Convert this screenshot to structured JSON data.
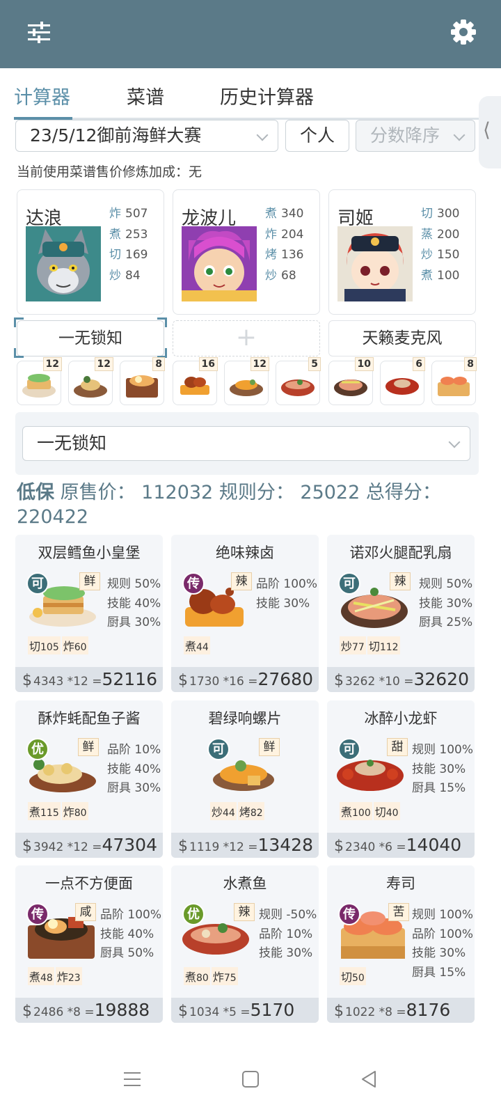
{
  "header": {
    "menu_icon": "sliders-icon",
    "settings_icon": "gear-icon",
    "bar_color": "#5b7a88"
  },
  "tabs": [
    {
      "label": "计算器",
      "active": true
    },
    {
      "label": "菜谱",
      "active": false
    },
    {
      "label": "历史计算器",
      "active": false
    }
  ],
  "filters": {
    "event": "23/5/12御前海鲜大赛",
    "mode": "个人",
    "sort": "分数降序"
  },
  "info_line": "当前使用菜谱售价修炼加成：无",
  "chefs": [
    {
      "name": "达浪",
      "stats": [
        {
          "k": "炸",
          "v": "507"
        },
        {
          "k": "煮",
          "v": "253"
        },
        {
          "k": "切",
          "v": "169"
        },
        {
          "k": "炒",
          "v": "84"
        }
      ]
    },
    {
      "name": "龙波儿",
      "stats": [
        {
          "k": "煮",
          "v": "340"
        },
        {
          "k": "炸",
          "v": "204"
        },
        {
          "k": "烤",
          "v": "136"
        },
        {
          "k": "炒",
          "v": "68"
        }
      ]
    },
    {
      "name": "司姬",
      "stats": [
        {
          "k": "切",
          "v": "300"
        },
        {
          "k": "蒸",
          "v": "200"
        },
        {
          "k": "炒",
          "v": "150"
        },
        {
          "k": "煮",
          "v": "100"
        }
      ]
    }
  ],
  "equips": [
    {
      "label": "一无锁知"
    },
    {
      "label": "+"
    },
    {
      "label": "天籁麦克风"
    }
  ],
  "ingredients": [
    "12",
    "12",
    "8",
    "16",
    "12",
    "5",
    "10",
    "6",
    "8"
  ],
  "panel": {
    "dropdown_value": "一无锁知"
  },
  "total": {
    "lowest": "低保",
    "text": " 原售价：  112032 规则分：  25022 总得分：",
    "score": "220422"
  },
  "recipes": [
    {
      "name": "双层鳕鱼小皇堡",
      "grade": "可",
      "flavor": "鲜",
      "bonus": [
        "规则 50%",
        "技能 40%",
        "厨具 30%"
      ],
      "skills": [
        {
          "k": "切",
          "v": "105"
        },
        {
          "k": "炸",
          "v": "60"
        }
      ],
      "price": "4343",
      "mult": "*12",
      "total": "52116"
    },
    {
      "name": "绝味辣卤",
      "grade": "传",
      "flavor": "辣",
      "bonus": [
        "品阶 100%",
        "技能 30%"
      ],
      "skills": [
        {
          "k": "煮",
          "v": "44"
        }
      ],
      "price": "1730",
      "mult": "*16",
      "total": "27680"
    },
    {
      "name": "诺邓火腿配乳扇",
      "grade": "可",
      "flavor": "辣",
      "bonus": [
        "规则 50%",
        "技能 30%",
        "厨具 25%"
      ],
      "skills": [
        {
          "k": "炒",
          "v": "77"
        },
        {
          "k": "切",
          "v": "112"
        }
      ],
      "price": "3262",
      "mult": "*10",
      "total": "32620"
    },
    {
      "name": "酥炸蚝配鱼子酱",
      "grade": "优",
      "flavor": "鲜",
      "bonus": [
        "品阶 10%",
        "技能 40%",
        "厨具 30%"
      ],
      "skills": [
        {
          "k": "煮",
          "v": "115"
        },
        {
          "k": "炸",
          "v": "80"
        }
      ],
      "price": "3942",
      "mult": "*12",
      "total": "47304"
    },
    {
      "name": "碧绿响螺片",
      "grade": "可",
      "flavor": "鲜",
      "bonus": [],
      "skills": [
        {
          "k": "炒",
          "v": "44"
        },
        {
          "k": "烤",
          "v": "82"
        }
      ],
      "price": "1119",
      "mult": "*12",
      "total": "13428"
    },
    {
      "name": "冰醉小龙虾",
      "grade": "可",
      "flavor": "甜",
      "bonus": [
        "规则 100%",
        "技能 30%",
        "厨具 15%"
      ],
      "skills": [
        {
          "k": "煮",
          "v": "100"
        },
        {
          "k": "切",
          "v": "40"
        }
      ],
      "price": "2340",
      "mult": "*6",
      "total": "14040"
    },
    {
      "name": "一点不方便面",
      "grade": "传",
      "flavor": "咸",
      "bonus": [
        "品阶 100%",
        "技能 40%",
        "厨具 50%"
      ],
      "skills": [
        {
          "k": "煮",
          "v": "48"
        },
        {
          "k": "炸",
          "v": "23"
        }
      ],
      "price": "2486",
      "mult": "*8",
      "total": "19888"
    },
    {
      "name": "水煮鱼",
      "grade": "优",
      "flavor": "辣",
      "bonus": [
        "规则 -50%",
        "品阶 10%",
        "技能 30%"
      ],
      "skills": [
        {
          "k": "煮",
          "v": "80"
        },
        {
          "k": "炸",
          "v": "75"
        }
      ],
      "price": "1034",
      "mult": "*5",
      "total": "5170"
    },
    {
      "name": "寿司",
      "grade": "传",
      "flavor": "苦",
      "bonus": [
        "规则 100%",
        "品阶 100%",
        "技能 30%",
        "厨具 15%"
      ],
      "skills": [
        {
          "k": "切",
          "v": "50"
        }
      ],
      "price": "1022",
      "mult": "*8",
      "total": "8176"
    }
  ],
  "grade_colors": {
    "可": "#3c6e78",
    "传": "#7a2a6a",
    "优": "#6a9a2a"
  },
  "nav": {
    "menu_icon": "menu-icon",
    "home_icon": "home-square-icon",
    "back_icon": "back-triangle-icon"
  }
}
